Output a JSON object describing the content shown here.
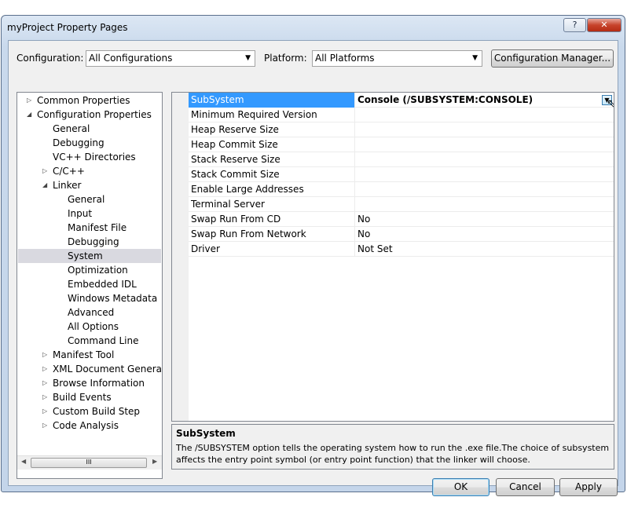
{
  "window": {
    "title": "myProject Property Pages",
    "help_label": "?",
    "close_label": "✕"
  },
  "toolbar": {
    "configuration_label": "Configuration:",
    "configuration_value": "All Configurations",
    "platform_label": "Platform:",
    "platform_value": "All Platforms",
    "config_manager_label": "Configuration Manager..."
  },
  "tree": {
    "items": [
      {
        "label": "Common Properties",
        "expander": "▷"
      },
      {
        "label": "Configuration Properties",
        "expander": "◢"
      },
      {
        "label": "General",
        "expander": ""
      },
      {
        "label": "Debugging",
        "expander": ""
      },
      {
        "label": "VC++ Directories",
        "expander": ""
      },
      {
        "label": "C/C++",
        "expander": "▷"
      },
      {
        "label": "Linker",
        "expander": "◢"
      },
      {
        "label": "General",
        "expander": ""
      },
      {
        "label": "Input",
        "expander": ""
      },
      {
        "label": "Manifest File",
        "expander": ""
      },
      {
        "label": "Debugging",
        "expander": ""
      },
      {
        "label": "System",
        "expander": ""
      },
      {
        "label": "Optimization",
        "expander": ""
      },
      {
        "label": "Embedded IDL",
        "expander": ""
      },
      {
        "label": "Windows Metadata",
        "expander": ""
      },
      {
        "label": "Advanced",
        "expander": ""
      },
      {
        "label": "All Options",
        "expander": ""
      },
      {
        "label": "Command Line",
        "expander": ""
      },
      {
        "label": "Manifest Tool",
        "expander": "▷"
      },
      {
        "label": "XML Document Generator",
        "expander": "▷"
      },
      {
        "label": "Browse Information",
        "expander": "▷"
      },
      {
        "label": "Build Events",
        "expander": "▷"
      },
      {
        "label": "Custom Build Step",
        "expander": "▷"
      },
      {
        "label": "Code Analysis",
        "expander": "▷"
      }
    ],
    "scroll_thumb_glyph": "III"
  },
  "properties": [
    {
      "name": "SubSystem",
      "value": "Console (/SUBSYSTEM:CONSOLE)"
    },
    {
      "name": "Minimum Required Version",
      "value": ""
    },
    {
      "name": "Heap Reserve Size",
      "value": ""
    },
    {
      "name": "Heap Commit Size",
      "value": ""
    },
    {
      "name": "Stack Reserve Size",
      "value": ""
    },
    {
      "name": "Stack Commit Size",
      "value": ""
    },
    {
      "name": "Enable Large Addresses",
      "value": ""
    },
    {
      "name": "Terminal Server",
      "value": ""
    },
    {
      "name": "Swap Run From CD",
      "value": "No"
    },
    {
      "name": "Swap Run From Network",
      "value": "No"
    },
    {
      "name": "Driver",
      "value": "Not Set"
    }
  ],
  "description": {
    "title": "SubSystem",
    "text": "The /SUBSYSTEM option tells the operating system how to run the .exe file.The choice of subsystem affects the entry point symbol (or entry point function) that the linker will choose."
  },
  "buttons": {
    "ok": "OK",
    "cancel": "Cancel",
    "apply": "Apply"
  },
  "colors": {
    "selection": "#3399ff",
    "tree_selection": "#d9d9e0"
  }
}
